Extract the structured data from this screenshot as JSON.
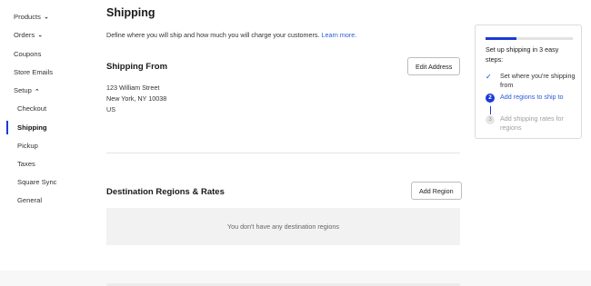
{
  "sidebar": {
    "items": [
      {
        "label": "Products",
        "has_chevron": true
      },
      {
        "label": "Orders",
        "has_chevron": true
      },
      {
        "label": "Coupons"
      },
      {
        "label": "Store Emails"
      },
      {
        "label": "Setup",
        "expanded": true
      }
    ],
    "setup_children": [
      "Checkout",
      "Shipping",
      "Pickup",
      "Taxes",
      "Square Sync",
      "General"
    ],
    "active_item": "Shipping",
    "chevron_down_glyph": "⌄",
    "chevron_up_glyph": "⌃"
  },
  "page": {
    "title": "Shipping",
    "intro_text": "Define where you will ship and how much you will charge your customers.",
    "learn_more_label": "Learn more."
  },
  "shipping_from": {
    "title": "Shipping From",
    "edit_button": "Edit Address",
    "address": [
      "123 William Street",
      "New York, NY 10038",
      "US"
    ]
  },
  "destination": {
    "title": "Destination Regions & Rates",
    "add_button": "Add Region",
    "empty_message": "You don't have any destination regions"
  },
  "setup_card": {
    "title": "Set up shipping in 3 easy steps:",
    "progress_fraction": 0.35,
    "steps": [
      {
        "label": "Set where you're shipping from",
        "state": "done",
        "marker": "✓"
      },
      {
        "label": "Add regions to ship to",
        "state": "current",
        "marker": "2"
      },
      {
        "label": "Add shipping rates for regions",
        "state": "pending",
        "marker": "3"
      }
    ]
  },
  "colors": {
    "accent": "#1a3ad9",
    "link": "#2a5bd7",
    "text": "#1a1a1a",
    "muted": "#9a9a9a",
    "empty_bg": "#f2f2f2"
  }
}
